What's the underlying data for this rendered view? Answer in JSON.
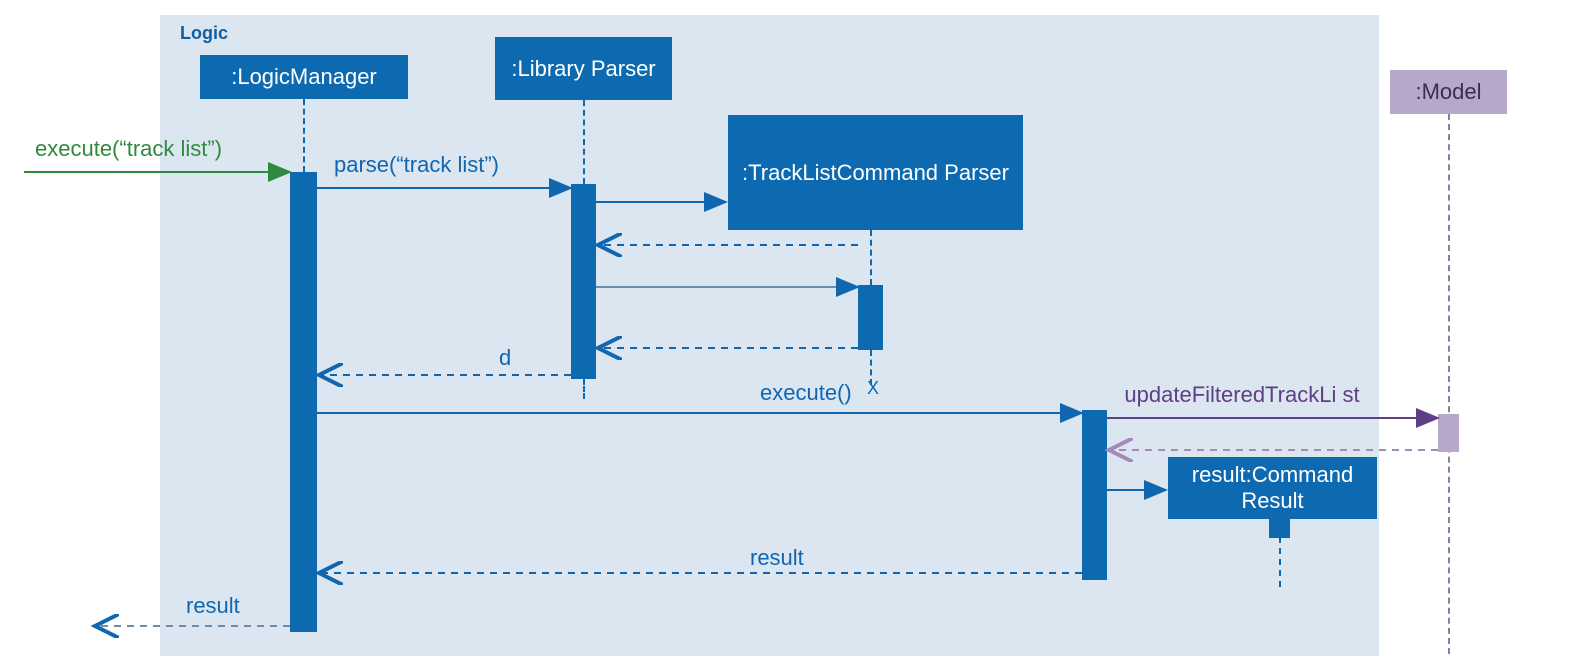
{
  "logic_label": "Logic",
  "participants": {
    "logic_manager": ":LogicManager",
    "library_parser": ":Library Parser",
    "tracklist_parser": ":TrackListCommand Parser",
    "model": ":Model",
    "result_box": "result:Command Result"
  },
  "messages": {
    "execute_in": "execute(“track list”)",
    "parse": "parse(“track list”)",
    "d": "d",
    "execute_call": "execute()",
    "update": "updateFilteredTrackLi st",
    "result1": "result",
    "result2": "result"
  },
  "colors": {
    "blue": "#0e6ab0",
    "green": "#2e8b3d",
    "purple": "#8c7ba0",
    "purple_text": "#5e3f85",
    "light_blue_bg": "#dbe6f0"
  },
  "chart_data": {
    "type": "sequence_diagram",
    "frame": "Logic",
    "participants": [
      {
        "id": "logic_manager",
        "label": ":LogicManager",
        "inside_frame": true
      },
      {
        "id": "library_parser",
        "label": ":Library Parser",
        "inside_frame": true
      },
      {
        "id": "tracklist_parser",
        "label": ":TrackListCommand Parser",
        "inside_frame": true,
        "created_during_sequence": true,
        "destroyed": true
      },
      {
        "id": "command_result",
        "label": "result:Command Result",
        "inside_frame": true,
        "created_during_sequence": true
      },
      {
        "id": "model",
        "label": ":Model",
        "inside_frame": false
      }
    ],
    "messages": [
      {
        "from": "external",
        "to": "logic_manager",
        "label": "execute(\"track list\")",
        "type": "sync"
      },
      {
        "from": "logic_manager",
        "to": "library_parser",
        "label": "parse(\"track list\")",
        "type": "sync"
      },
      {
        "from": "library_parser",
        "to": "tracklist_parser",
        "label": "",
        "type": "create"
      },
      {
        "from": "tracklist_parser",
        "to": "library_parser",
        "label": "",
        "type": "return"
      },
      {
        "from": "library_parser",
        "to": "tracklist_parser",
        "label": "",
        "type": "sync"
      },
      {
        "from": "tracklist_parser",
        "to": "library_parser",
        "label": "",
        "type": "return"
      },
      {
        "from": "library_parser",
        "to": "logic_manager",
        "label": "d",
        "type": "return"
      },
      {
        "from": "logic_manager",
        "to": "tracklist_parser_instance",
        "label": "execute()",
        "type": "sync",
        "note": "destroys tracklist_parser"
      },
      {
        "from": "tracklist_parser_instance",
        "to": "model",
        "label": "updateFilteredTrackList",
        "type": "sync"
      },
      {
        "from": "model",
        "to": "tracklist_parser_instance",
        "label": "",
        "type": "return"
      },
      {
        "from": "tracklist_parser_instance",
        "to": "command_result",
        "label": "",
        "type": "create"
      },
      {
        "from": "tracklist_parser_instance",
        "to": "logic_manager",
        "label": "result",
        "type": "return"
      },
      {
        "from": "logic_manager",
        "to": "external",
        "label": "result",
        "type": "return"
      }
    ]
  }
}
